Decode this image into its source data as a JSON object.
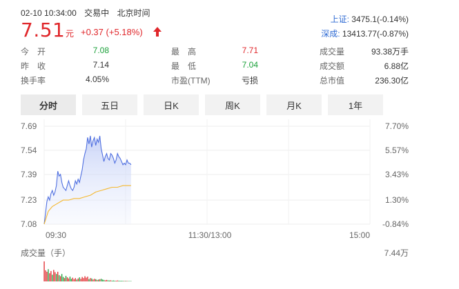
{
  "header": {
    "datetime": "02-10 10:34:00",
    "trade_status": "交易中",
    "timezone": "北京时间",
    "price": "7.51",
    "unit": "元",
    "change": "+0.37",
    "change_pct": "(+5.18%)",
    "direction_icon": "up-arrow-icon"
  },
  "indices": [
    {
      "name": "上证:",
      "value": "3475.1(-0.14%)"
    },
    {
      "name": "深成:",
      "value": "13413.77(-0.87%)"
    }
  ],
  "quote": {
    "col1": [
      {
        "label": "今　开",
        "value": "7.08",
        "color": "#1aa039"
      },
      {
        "label": "昨　收",
        "value": "7.14",
        "color": "#333333"
      },
      {
        "label": "换手率",
        "value": "4.05%",
        "color": "#333333"
      }
    ],
    "col2": [
      {
        "label": "最　高",
        "value": "7.71",
        "color": "#e0262a"
      },
      {
        "label": "最　低",
        "value": "7.04",
        "color": "#1aa039"
      },
      {
        "label": "市盈(TTM)",
        "value": "亏损",
        "color": "#333333"
      }
    ],
    "col3": [
      {
        "label": "成交量",
        "value": "93.38万手"
      },
      {
        "label": "成交额",
        "value": "6.88亿"
      },
      {
        "label": "总市值",
        "value": "236.30亿"
      }
    ]
  },
  "tabs": [
    {
      "label": "分时",
      "active": true
    },
    {
      "label": "五日",
      "active": false
    },
    {
      "label": "日K",
      "active": false
    },
    {
      "label": "周K",
      "active": false
    },
    {
      "label": "月K",
      "active": false
    },
    {
      "label": "1年",
      "active": false
    }
  ],
  "chart_data": {
    "type": "line",
    "price_ticks": [
      "7.69",
      "7.54",
      "7.39",
      "7.23",
      "7.08"
    ],
    "pct_ticks": [
      "7.70%",
      "5.57%",
      "3.43%",
      "1.30%",
      "-0.84%"
    ],
    "time_ticks": [
      "09:30",
      "11:30/13:00",
      "15:00"
    ],
    "ylim": [
      7.08,
      7.69
    ],
    "prev_close": 7.14,
    "minutes_total": 240,
    "series": [
      {
        "role": "price",
        "color": "#4f6fe0",
        "minutes": [
          0,
          1,
          2,
          3,
          4,
          5,
          6,
          7,
          8,
          9,
          10,
          11,
          12,
          13,
          14,
          15,
          16,
          17,
          18,
          19,
          20,
          21,
          22,
          23,
          24,
          25,
          26,
          27,
          28,
          29,
          30,
          31,
          32,
          33,
          34,
          35,
          36,
          37,
          38,
          39,
          40,
          41,
          42,
          43,
          44,
          45,
          46,
          47,
          48,
          49,
          50,
          51,
          52,
          53,
          54,
          55,
          56,
          57,
          58,
          59,
          60,
          61,
          62,
          63,
          64
        ],
        "values": [
          7.08,
          7.15,
          7.22,
          7.25,
          7.23,
          7.27,
          7.29,
          7.26,
          7.28,
          7.32,
          7.41,
          7.38,
          7.39,
          7.34,
          7.31,
          7.3,
          7.29,
          7.32,
          7.35,
          7.32,
          7.3,
          7.29,
          7.31,
          7.35,
          7.33,
          7.36,
          7.34,
          7.38,
          7.42,
          7.48,
          7.52,
          7.55,
          7.62,
          7.58,
          7.63,
          7.56,
          7.6,
          7.62,
          7.57,
          7.61,
          7.59,
          7.63,
          7.55,
          7.51,
          7.47,
          7.5,
          7.52,
          7.49,
          7.48,
          7.52,
          7.51,
          7.49,
          7.46,
          7.48,
          7.52,
          7.5,
          7.49,
          7.47,
          7.45,
          7.46,
          7.45,
          7.48,
          7.46,
          7.46,
          7.45
        ]
      },
      {
        "role": "average",
        "color": "#f5b82e",
        "minutes": [
          0,
          3,
          6,
          10,
          14,
          18,
          22,
          26,
          30,
          34,
          38,
          42,
          46,
          50,
          54,
          58,
          62,
          64
        ],
        "values": [
          7.08,
          7.16,
          7.19,
          7.21,
          7.23,
          7.23,
          7.24,
          7.24,
          7.25,
          7.26,
          7.28,
          7.29,
          7.3,
          7.31,
          7.31,
          7.32,
          7.32,
          7.32
        ]
      }
    ],
    "volume_label": "成交量（手）",
    "volume_max_label": "7.44万",
    "volume_max": 74400,
    "volume": [
      {
        "minute": 0,
        "value": 54000,
        "up": true
      },
      {
        "minute": 1,
        "value": 30000,
        "up": true
      },
      {
        "minute": 2,
        "value": 26000,
        "up": true
      },
      {
        "minute": 3,
        "value": 33000,
        "up": false
      },
      {
        "minute": 4,
        "value": 22000,
        "up": true
      },
      {
        "minute": 5,
        "value": 28000,
        "up": true
      },
      {
        "minute": 6,
        "value": 18000,
        "up": false
      },
      {
        "minute": 7,
        "value": 31000,
        "up": true
      },
      {
        "minute": 8,
        "value": 25000,
        "up": true
      },
      {
        "minute": 9,
        "value": 20000,
        "up": false
      },
      {
        "minute": 10,
        "value": 26000,
        "up": true
      },
      {
        "minute": 11,
        "value": 17000,
        "up": false
      },
      {
        "minute": 12,
        "value": 14000,
        "up": true
      },
      {
        "minute": 13,
        "value": 20000,
        "up": false
      },
      {
        "minute": 14,
        "value": 12000,
        "up": false
      },
      {
        "minute": 15,
        "value": 9000,
        "up": true
      },
      {
        "minute": 16,
        "value": 15000,
        "up": false
      },
      {
        "minute": 17,
        "value": 11000,
        "up": true
      },
      {
        "minute": 18,
        "value": 8000,
        "up": true
      },
      {
        "minute": 19,
        "value": 13000,
        "up": false
      },
      {
        "minute": 20,
        "value": 7000,
        "up": false
      },
      {
        "minute": 21,
        "value": 10000,
        "up": true
      },
      {
        "minute": 22,
        "value": 6000,
        "up": true
      },
      {
        "minute": 23,
        "value": 9000,
        "up": true
      },
      {
        "minute": 24,
        "value": 5000,
        "up": false
      },
      {
        "minute": 25,
        "value": 8000,
        "up": true
      },
      {
        "minute": 26,
        "value": 11000,
        "up": false
      },
      {
        "minute": 27,
        "value": 7000,
        "up": true
      },
      {
        "minute": 28,
        "value": 12000,
        "up": true
      },
      {
        "minute": 29,
        "value": 9000,
        "up": true
      },
      {
        "minute": 30,
        "value": 14000,
        "up": true
      },
      {
        "minute": 31,
        "value": 10000,
        "up": true
      },
      {
        "minute": 32,
        "value": 13000,
        "up": true
      },
      {
        "minute": 33,
        "value": 6000,
        "up": false
      },
      {
        "minute": 34,
        "value": 9000,
        "up": true
      },
      {
        "minute": 35,
        "value": 8000,
        "up": false
      },
      {
        "minute": 36,
        "value": 5000,
        "up": true
      },
      {
        "minute": 37,
        "value": 7000,
        "up": true
      },
      {
        "minute": 38,
        "value": 6000,
        "up": false
      },
      {
        "minute": 39,
        "value": 4000,
        "up": true
      },
      {
        "minute": 40,
        "value": 5000,
        "up": false
      },
      {
        "minute": 41,
        "value": 6000,
        "up": true
      },
      {
        "minute": 42,
        "value": 7000,
        "up": false
      },
      {
        "minute": 43,
        "value": 5000,
        "up": false
      },
      {
        "minute": 44,
        "value": 4000,
        "up": false
      },
      {
        "minute": 45,
        "value": 3000,
        "up": true
      },
      {
        "minute": 46,
        "value": 4000,
        "up": true
      },
      {
        "minute": 47,
        "value": 3000,
        "up": false
      },
      {
        "minute": 48,
        "value": 2500,
        "up": false
      },
      {
        "minute": 49,
        "value": 3000,
        "up": true
      },
      {
        "minute": 50,
        "value": 2000,
        "up": false
      },
      {
        "minute": 51,
        "value": 2500,
        "up": false
      },
      {
        "minute": 52,
        "value": 2000,
        "up": false
      },
      {
        "minute": 53,
        "value": 1800,
        "up": true
      },
      {
        "minute": 54,
        "value": 2500,
        "up": true
      },
      {
        "minute": 55,
        "value": 2000,
        "up": false
      },
      {
        "minute": 56,
        "value": 1500,
        "up": false
      },
      {
        "minute": 57,
        "value": 1800,
        "up": false
      },
      {
        "minute": 58,
        "value": 1500,
        "up": false
      },
      {
        "minute": 59,
        "value": 1200,
        "up": true
      },
      {
        "minute": 60,
        "value": 1500,
        "up": false
      },
      {
        "minute": 61,
        "value": 1200,
        "up": true
      },
      {
        "minute": 62,
        "value": 1000,
        "up": false
      },
      {
        "minute": 63,
        "value": 1000,
        "up": false
      },
      {
        "minute": 64,
        "value": 900,
        "up": false
      }
    ]
  }
}
